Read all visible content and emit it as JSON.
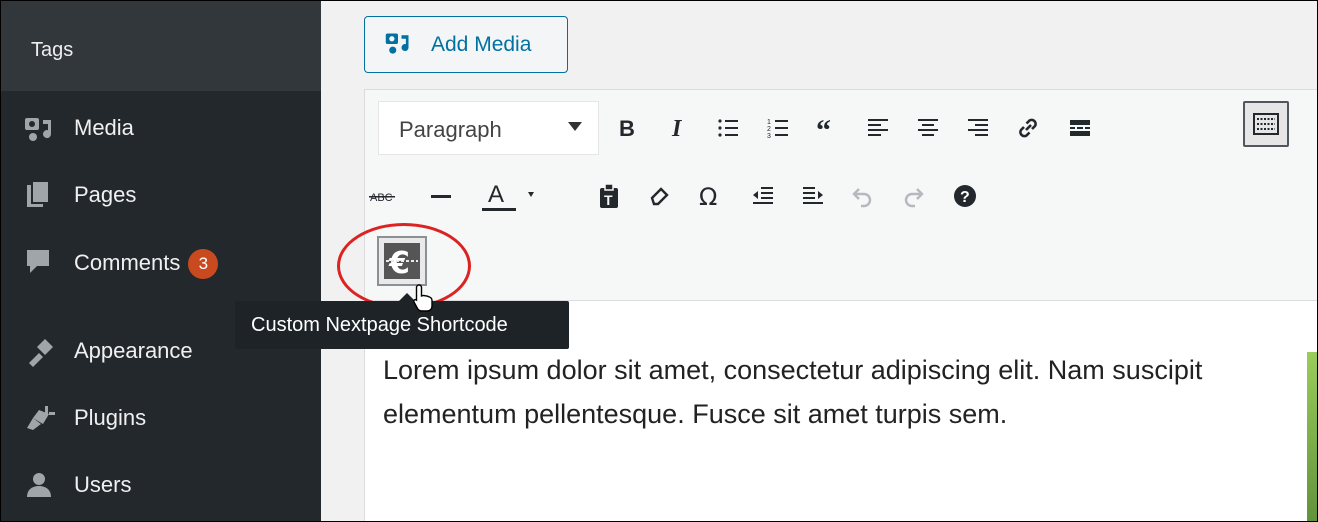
{
  "sidebar": {
    "submenu_current": "Tags",
    "items": [
      {
        "label": "Media",
        "icon": "media-icon"
      },
      {
        "label": "Pages",
        "icon": "pages-icon"
      },
      {
        "label": "Comments",
        "icon": "comments-icon",
        "badge": "3"
      },
      {
        "label": "Appearance",
        "icon": "appearance-icon"
      },
      {
        "label": "Plugins",
        "icon": "plugins-icon"
      },
      {
        "label": "Users",
        "icon": "users-icon"
      }
    ]
  },
  "editor": {
    "add_media_label": "Add Media",
    "format_select": "Paragraph",
    "toolbar_row1": [
      "bold-icon",
      "italic-icon",
      "bullet-list-icon",
      "numbered-list-icon",
      "blockquote-icon",
      "align-left-icon",
      "align-center-icon",
      "align-right-icon",
      "link-icon",
      "read-more-icon",
      "toolbar-toggle-icon"
    ],
    "toolbar_row2": [
      "strikethrough-icon",
      "horizontal-line-icon",
      "text-color-icon",
      "paste-text-icon",
      "clear-formatting-icon",
      "special-character-icon",
      "outdent-icon",
      "indent-icon",
      "undo-icon",
      "redo-icon",
      "help-icon"
    ],
    "custom_button_icon": "custom-nextpage-shortcode-icon",
    "tooltip": "Custom Nextpage Shortcode",
    "content": "Lorem ipsum dolor sit amet, consectetur adipiscing elit. Nam suscipit elementum pellentesque. Fusce sit amet turpis sem."
  },
  "colors": {
    "sidebar_bg": "#23282d",
    "badge": "#ca4a1f",
    "accent": "#0071a1",
    "callout": "#dd2222"
  }
}
